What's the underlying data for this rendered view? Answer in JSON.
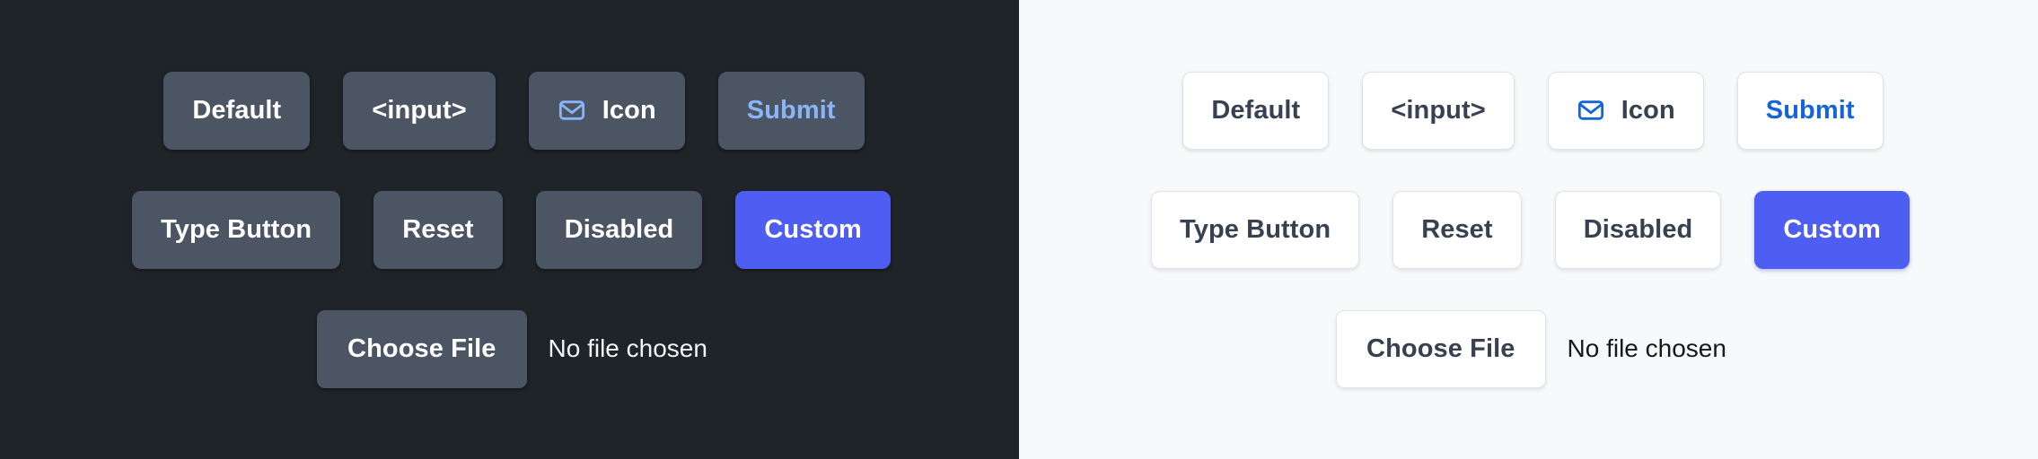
{
  "panels": [
    {
      "theme": "dark",
      "background": "#1f2428",
      "button_bg": "#4b5563",
      "text_color": "#ffffff",
      "accent": "#8ab4f8",
      "custom_color": "#4f5ef2",
      "rows": [
        {
          "buttons": [
            {
              "label": "Default",
              "variant": "default"
            },
            {
              "label": "<input>",
              "variant": "input"
            },
            {
              "label": "Icon",
              "variant": "icon",
              "icon": "mail-icon"
            },
            {
              "label": "Submit",
              "variant": "submit"
            }
          ]
        },
        {
          "buttons": [
            {
              "label": "Type Button",
              "variant": "type-button"
            },
            {
              "label": "Reset",
              "variant": "reset"
            },
            {
              "label": "Disabled",
              "variant": "disabled"
            },
            {
              "label": "Custom",
              "variant": "custom"
            }
          ]
        },
        {
          "file_button_label": "Choose File",
          "file_status": "No file chosen"
        }
      ]
    },
    {
      "theme": "light",
      "background": "#f7f9fb",
      "button_bg": "#ffffff",
      "border_color": "#dfe3e8",
      "text_color": "#374151",
      "accent": "#1565d8",
      "custom_color": "#4f5ef2",
      "rows": [
        {
          "buttons": [
            {
              "label": "Default",
              "variant": "default"
            },
            {
              "label": "<input>",
              "variant": "input"
            },
            {
              "label": "Icon",
              "variant": "icon",
              "icon": "mail-icon"
            },
            {
              "label": "Submit",
              "variant": "submit"
            }
          ]
        },
        {
          "buttons": [
            {
              "label": "Type Button",
              "variant": "type-button"
            },
            {
              "label": "Reset",
              "variant": "reset"
            },
            {
              "label": "Disabled",
              "variant": "disabled"
            },
            {
              "label": "Custom",
              "variant": "custom"
            }
          ]
        },
        {
          "file_button_label": "Choose File",
          "file_status": "No file chosen"
        }
      ]
    }
  ]
}
